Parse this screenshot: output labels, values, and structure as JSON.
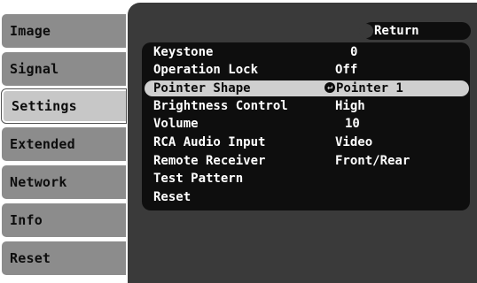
{
  "sidebar": {
    "items": [
      {
        "label": "Image"
      },
      {
        "label": "Signal"
      },
      {
        "label": "Settings"
      },
      {
        "label": "Extended"
      },
      {
        "label": "Network"
      },
      {
        "label": "Info"
      },
      {
        "label": "Reset"
      }
    ],
    "active_index": 2
  },
  "panel": {
    "return_label": "Return",
    "rows": [
      {
        "label": "Keystone",
        "value": "0"
      },
      {
        "label": "Operation Lock",
        "value": "Off"
      },
      {
        "label": "Pointer Shape",
        "value": "Pointer 1",
        "selected": true,
        "icon": "enter-icon"
      },
      {
        "label": "Brightness Control",
        "value": "High"
      },
      {
        "label": "Volume",
        "value": "10"
      },
      {
        "label": "RCA Audio Input",
        "value": "Video"
      },
      {
        "label": "Remote Receiver",
        "value": "Front/Rear"
      },
      {
        "label": "Test Pattern",
        "value": ""
      },
      {
        "label": "Reset",
        "value": ""
      }
    ]
  },
  "colors": {
    "panel_bg": "#3a3a3a",
    "menu_bg": "#0e0e0e",
    "highlight": "#cfcfcf",
    "tab_inactive": "#8c8c8c",
    "tab_active": "#c7c7c7"
  }
}
